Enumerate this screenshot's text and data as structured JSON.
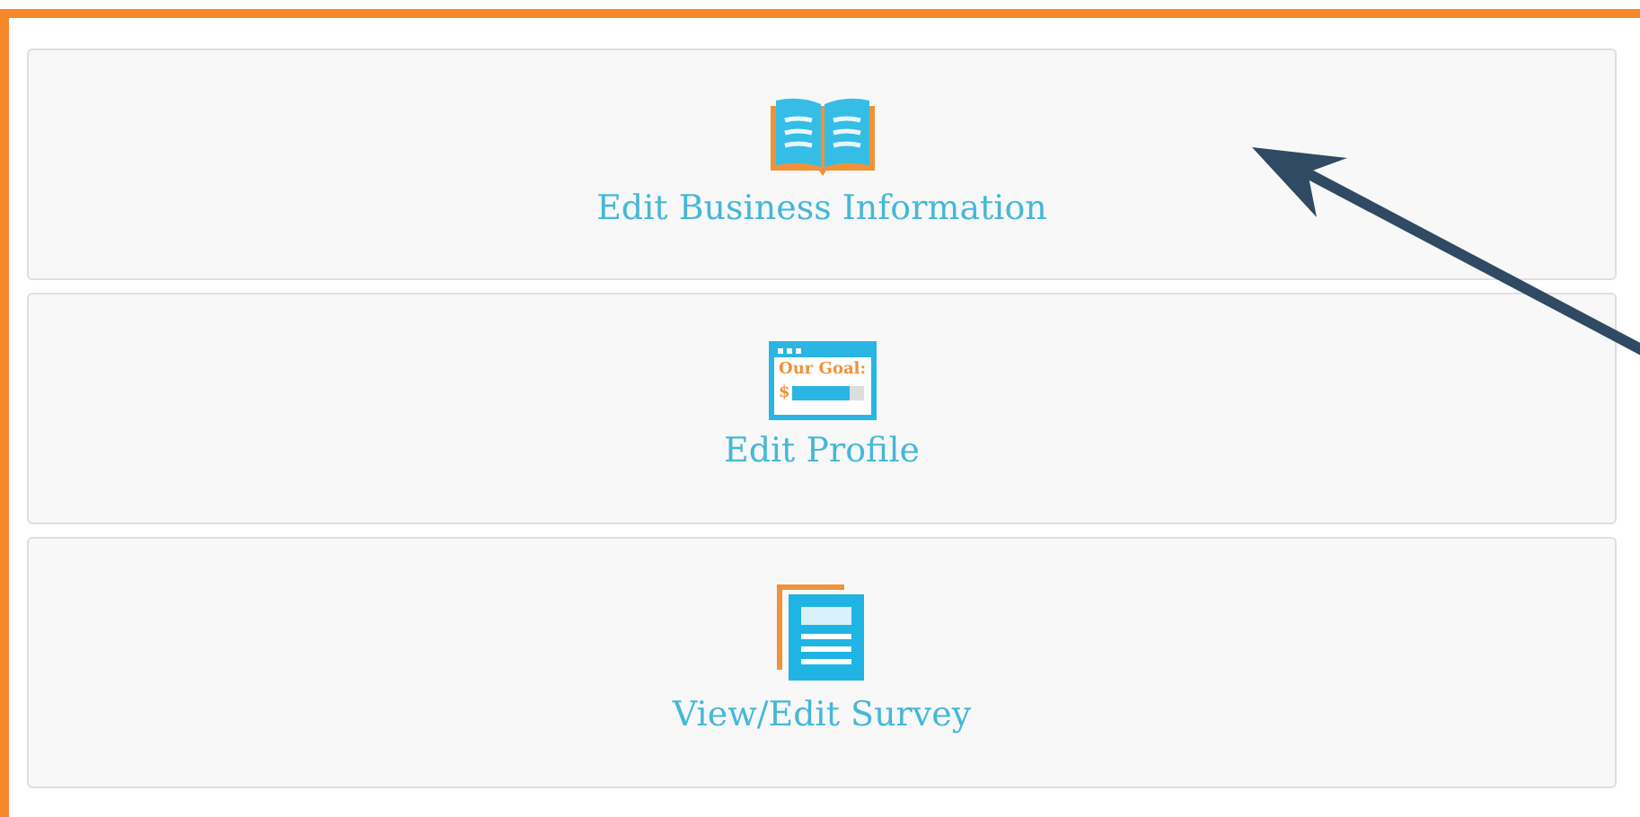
{
  "cards": [
    {
      "kind": "book",
      "label": "Edit Business Information"
    },
    {
      "kind": "goal",
      "label": "Edit Profile",
      "icon_texts": [
        "Our Goal:",
        "$"
      ]
    },
    {
      "kind": "survey",
      "label": "View/Edit Survey"
    }
  ]
}
